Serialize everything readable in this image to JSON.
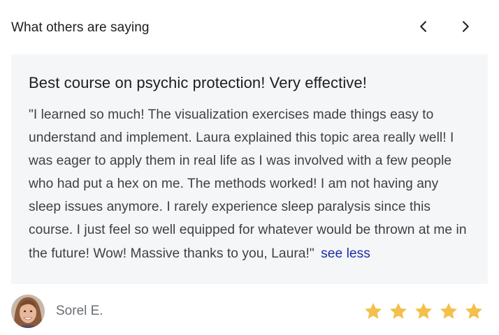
{
  "header": {
    "title": "What others are saying"
  },
  "nav": {
    "prev_icon": "chevron-left-icon",
    "next_icon": "chevron-right-icon"
  },
  "review": {
    "title": "Best course on psychic protection! Very effective!",
    "body": "\"I learned so much! The visualization exercises made things easy to understand and implement.  Laura explained this topic area really well! I was eager to apply them in real life as I was involved with a few people who had put a hex on me. The methods worked! I am not having any sleep issues anymore. I rarely experience sleep paralysis since this course. I just feel so well equipped for whatever would be thrown at me in the future! Wow! Massive thanks to you, Laura!\"",
    "toggle_label": "see less",
    "reviewer": "Sorel E.",
    "rating": 5,
    "rating_max": 5
  },
  "colors": {
    "card_bg": "#f5f6f8",
    "link": "#1b2fa8",
    "star": "#f3c04b"
  }
}
